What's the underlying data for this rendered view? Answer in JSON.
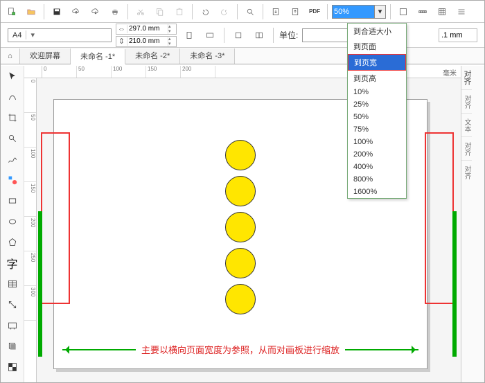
{
  "toolbar1": {
    "zoom_value": "50%"
  },
  "toolbar2": {
    "paper": "A4",
    "width": "297.0 mm",
    "height": "210.0 mm",
    "units_label": "单位:",
    "outline_value": ".1 mm"
  },
  "tabs": {
    "items": [
      "欢迎屏幕",
      "未命名 -1*",
      "未命名 -2*",
      "未命名 -3*"
    ],
    "active_index": 1
  },
  "ruler": {
    "h": [
      "0",
      "50",
      "100",
      "150",
      "200"
    ],
    "v": [
      "0",
      "50",
      "100",
      "150",
      "200",
      "250",
      "300"
    ],
    "unit": "毫米"
  },
  "zoom_menu": {
    "items": [
      "到合适大小",
      "到页面",
      "到页宽",
      "到页高",
      "10%",
      "25%",
      "50%",
      "75%",
      "100%",
      "200%",
      "400%",
      "800%",
      "1600%"
    ],
    "selected_index": 2
  },
  "caption": "主要以横向页面宽度为参照，从而对画板进行缩放",
  "right_panel": {
    "title": "对齐",
    "items": [
      "对齐",
      "文本",
      "对齐",
      "对齐"
    ]
  },
  "text_icon": "字"
}
